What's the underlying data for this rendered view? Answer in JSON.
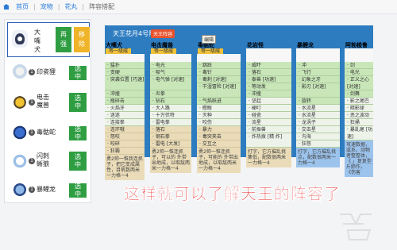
{
  "breadcrumb": [
    {
      "label": "首页",
      "current": false
    },
    {
      "label": "宠物",
      "current": false
    },
    {
      "label": "花丸",
      "current": false
    },
    {
      "label": "阵容搭配",
      "current": true
    }
  ],
  "selected_pokemon": {
    "name": "大嘴犬",
    "heal_label": "再强",
    "remove_label": "移除"
  },
  "pokemon_list": [
    {
      "num": "1",
      "name": "印瓷狸",
      "button": "选中",
      "sprite": "sprite-red"
    },
    {
      "num": "1",
      "name": "电击魔兽",
      "button": "选中",
      "sprite": "sprite-elec"
    },
    {
      "num": "1",
      "name": "毒骷蛇",
      "button": "选中",
      "sprite": "sprite-blue"
    },
    {
      "num": "1",
      "name": "闪刺蜥狼",
      "button": "选中",
      "sprite": "sprite-white"
    },
    {
      "num": "1",
      "name": "暴鲤龙",
      "button": "选中",
      "sprite": "sprite-ice"
    }
  ],
  "team": {
    "title": "天王花月4号队伍",
    "tag": "天王阵容",
    "tooltip": "编辑",
    "columns": [
      {
        "name": "大嘴犬",
        "level": "等一级威",
        "moves": [
          "· 猛扑",
          "· 变硬",
          "· 突袭位置 [巧速]",
          "· 冲撞",
          "· 瓶碎击",
          "· 火焰牙",
          "· 迷迷",
          "· 连接拳",
          "· 连环哦",
          "· 怒咬",
          "· 咬碎",
          "· 狂霸"
        ],
        "note": "勇2帅一惟我连抓子，把它变成属性，目帆数两米一力格一4"
      },
      {
        "name": "电击魔兽",
        "level": "等一级威",
        "moves": [
          "· 电光",
          "· 吸气",
          "· 电气弹 [对速]",
          "· 炎拳",
          "· 钻石",
          "· 大人路",
          "· 十万伏特",
          "· 雷电拳",
          "· 落石",
          "· 钢石拳",
          "· 雷电 [大发]"
        ],
        "note": "勇2帅一惟连抓子，可以的 外带出地成，以取敌两米一力格一4"
      },
      {
        "name": "毒骷蛇",
        "level": "等一级威",
        "moves": [
          "· 跳跃",
          "· 毒针",
          "· 毒刺 [对速]",
          "· 干湿冒险 [对速]",
          "· 气焰跃进",
          "· 瞪眼",
          "· 灭种",
          "· 咬伤",
          "· 暴力",
          "· 毒突夹击",
          "· 交互之"
        ],
        "note": "勇2帅一惟连抓子，可能的 外带出地成，以取敌两米一力格一4"
      },
      {
        "name": "花岩怪",
        "level": "",
        "moves": [
          "· 威吓",
          "· 落石",
          "· 泰兽 [功速]",
          "· 等动发",
          "· 冲撞",
          "· 坚起",
          "· 硬叮",
          "· 碰瓷",
          "· 流星",
          "· 前振兽",
          "· 炸热拨 [精·炸]"
        ],
        "note": "打字，它方摧乱挑集低，配数很两米一力格一4"
      },
      {
        "name": "暴鲤龙",
        "level": "",
        "moves": [
          "· 冲",
          "· 飞行",
          "· 幻象之牙",
          "· 影刃 [对速]",
          "· 旋转",
          "· 水流星",
          "· 水流星",
          "· 龙涡子",
          "· 交击星",
          "· 沟海",
          "· 狂怒"
        ],
        "note": "打字，它方摧乱挑点，配数很两米一力格一4"
      },
      {
        "name": "阿勃梭鲁",
        "level": "",
        "moves": [
          "· 剑",
          "· 电光",
          "· 正义之心 [对速]",
          "· 剑舞",
          "· 影之尾巴",
          "· 暗影球",
          "· 恶之波动",
          "· 狂捅",
          "· 暴乱尾 [功速]"
        ],
        "note": "攻速数据，或系，动物者整整体，《 」复复型斤肺作，《伤害"
      }
    ]
  },
  "subtitle": "这样就可以了解天王的阵容了"
}
